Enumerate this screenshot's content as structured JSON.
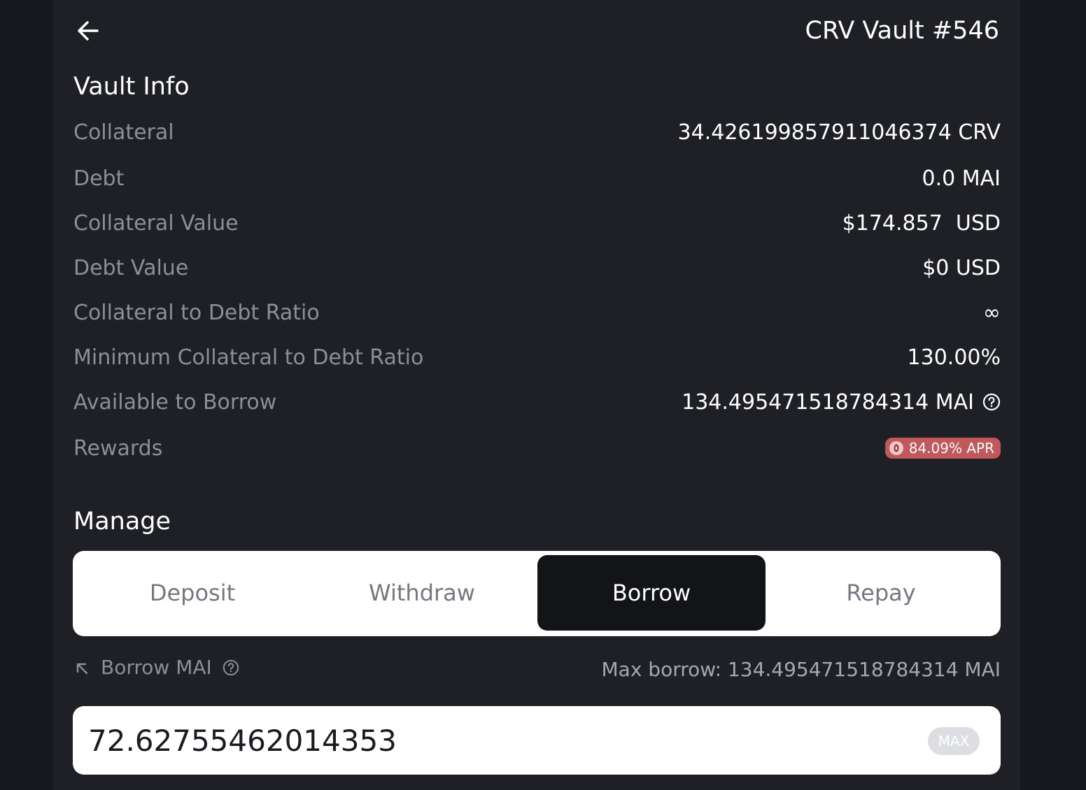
{
  "header": {
    "title": "CRV Vault #546",
    "back_icon": "arrow-left-icon"
  },
  "vault_info": {
    "title": "Vault Info",
    "rows": [
      {
        "label": "Collateral",
        "value": "34.426199857911046374 CRV"
      },
      {
        "label": "Debt",
        "value": "0.0 MAI"
      },
      {
        "label": "Collateral Value",
        "value": "$174.857  USD"
      },
      {
        "label": "Debt Value",
        "value": "$0 USD"
      },
      {
        "label": "Collateral to Debt Ratio",
        "value": "∞"
      },
      {
        "label": "Minimum Collateral to Debt Ratio",
        "value": "130.00%"
      },
      {
        "label": "Available to Borrow",
        "value": "134.495471518784314 MAI"
      },
      {
        "label": "Rewards",
        "value": "84.09% APR"
      }
    ]
  },
  "manage": {
    "title": "Manage",
    "tabs": [
      {
        "label": "Deposit",
        "active": false
      },
      {
        "label": "Withdraw",
        "active": false
      },
      {
        "label": "Borrow",
        "active": true
      },
      {
        "label": "Repay",
        "active": false
      }
    ],
    "borrow_label": "Borrow MAI",
    "max_borrow_text": "Max borrow: 134.495471518784314 MAI",
    "amount_value": "72.62755462014353",
    "max_button_label": "MAX"
  },
  "colors": {
    "background": "#17181d",
    "panel": "#1e2026",
    "accent_badge": "#c0585c",
    "active_tab": "#131418"
  }
}
